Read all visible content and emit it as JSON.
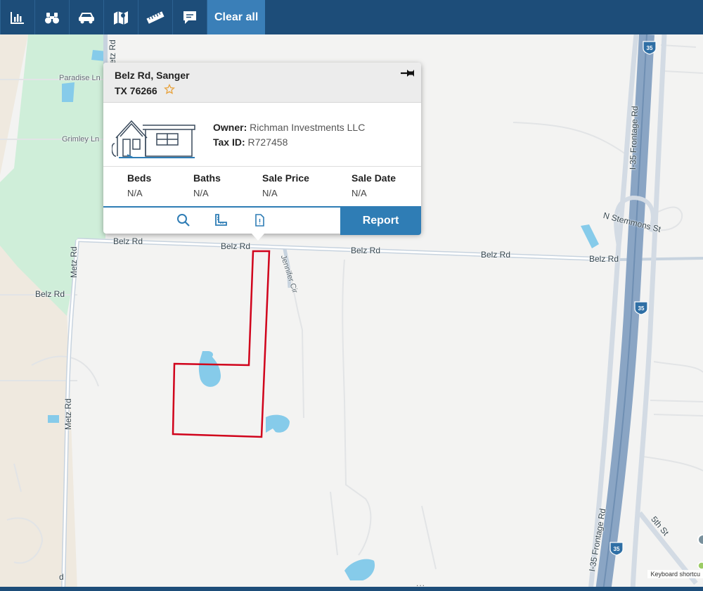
{
  "toolbar": {
    "buttons": [
      {
        "icon": "bar-chart-icon"
      },
      {
        "icon": "binoculars-icon"
      },
      {
        "icon": "car-icon"
      },
      {
        "icon": "map-icon"
      },
      {
        "icon": "ruler-icon"
      },
      {
        "icon": "comment-icon"
      }
    ],
    "clear_label": "Clear all"
  },
  "map": {
    "labels": {
      "paradise_ln": "Paradise Ln",
      "grimley_ln": "Grimley Ln",
      "metz_rd_top": "Metz Rd",
      "metz_rd_left": "Metz Rd",
      "belz_rd_west": "Belz Rd",
      "belz_rd_1": "Belz Rd",
      "belz_rd_2": "Belz Rd",
      "belz_rd_3": "Belz Rd",
      "belz_rd_4": "Belz Rd",
      "belz_rd_5": "Belz Rd",
      "jennifer_cir": "Jennifer Cir",
      "i35_frontage_top": "I-35 Frontage Rd",
      "i35_frontage_bottom": "I-35 Frontage Rd",
      "n_stemmons": "N Stemmons St",
      "fifth_st": "5th St",
      "i35_shield": "35",
      "partial_rd": "d"
    },
    "keyboard_shortcuts": "Keyboard shortcu"
  },
  "popup": {
    "address_line1": "Belz Rd, Sanger",
    "address_line2": "TX 76266",
    "owner_label": "Owner:",
    "owner_value": "Richman Investments LLC",
    "taxid_label": "Tax ID:",
    "taxid_value": "R727458",
    "stats": [
      {
        "label": "Beds",
        "value": "N/A"
      },
      {
        "label": "Baths",
        "value": "N/A"
      },
      {
        "label": "Sale Price",
        "value": "N/A"
      },
      {
        "label": "Sale Date",
        "value": "N/A"
      }
    ],
    "report_label": "Report"
  },
  "colors": {
    "toolbar": "#1d4d79",
    "accent": "#2f7db5",
    "parcel_outline": "#d0021b",
    "water": "#86cbea",
    "park": "#cfeed9",
    "highway": "#8aa5c4"
  },
  "footer": {
    "dots": "..."
  }
}
